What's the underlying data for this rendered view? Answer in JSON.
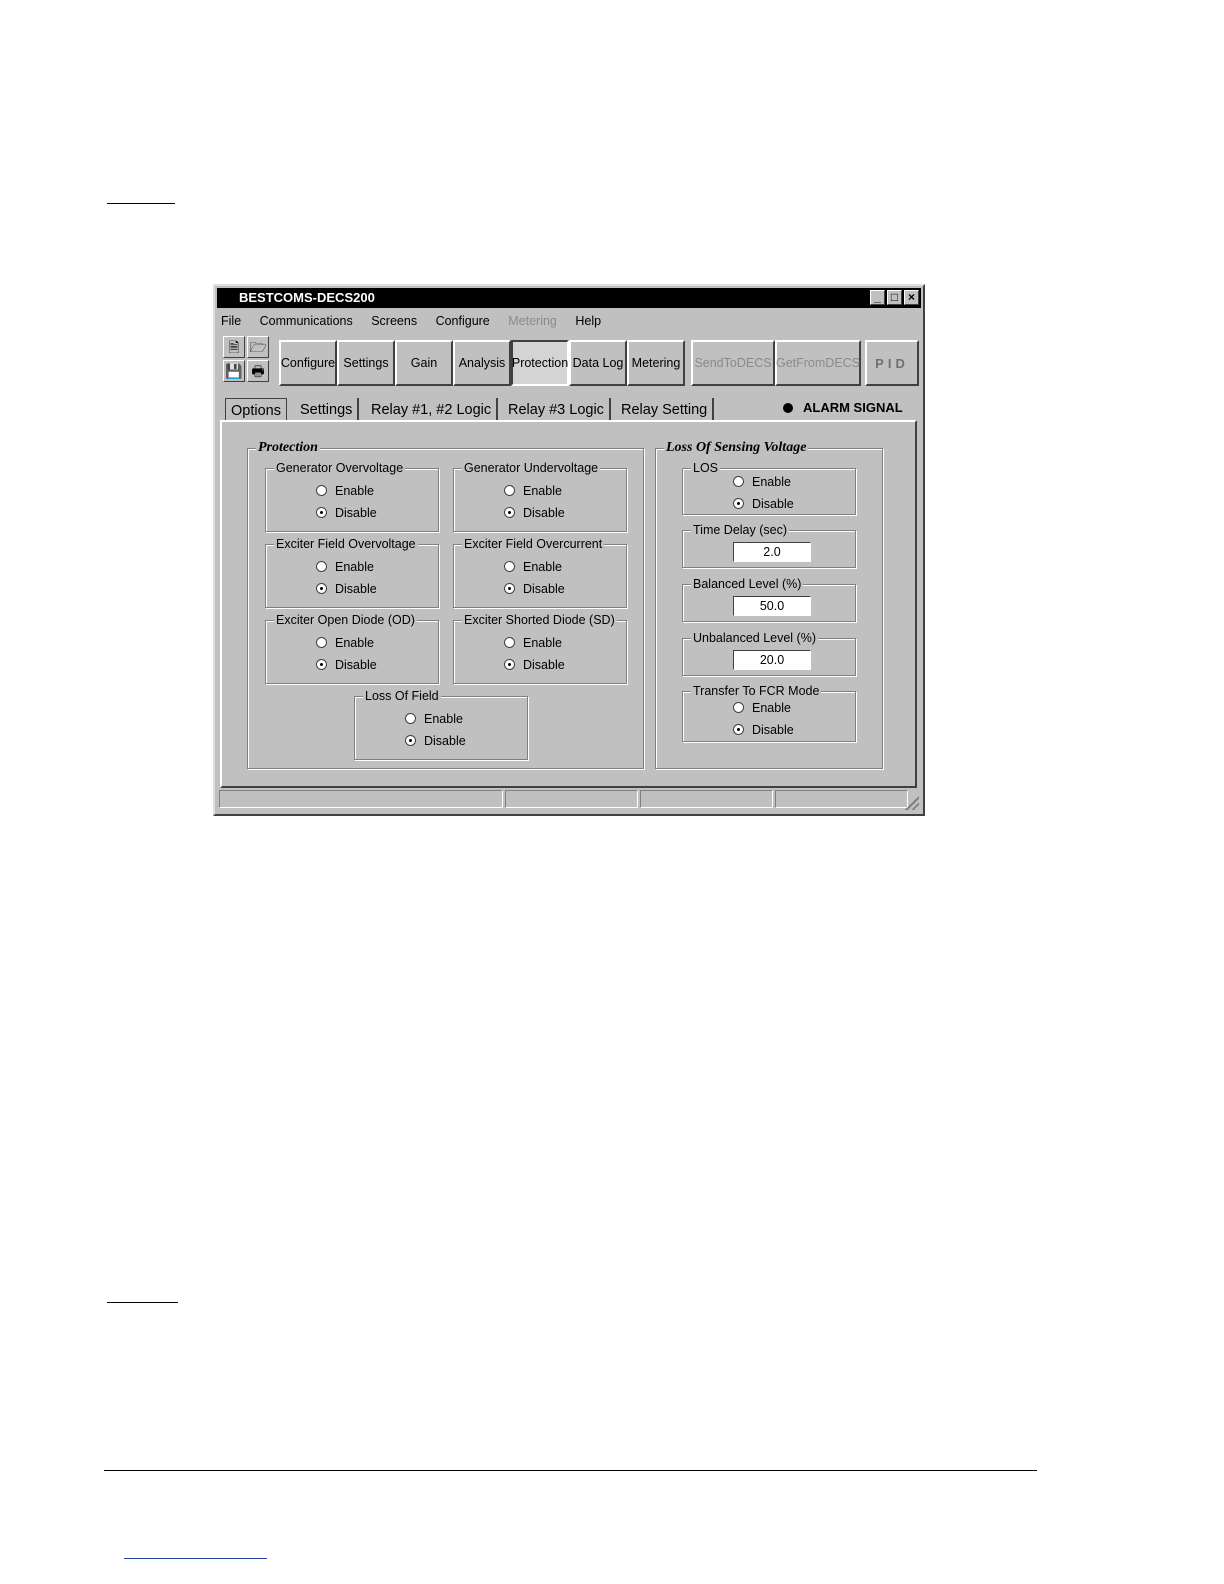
{
  "window": {
    "title": "BESTCOMS-DECS200",
    "minimize_label": "_",
    "maximize_label": "□",
    "close_label": "×"
  },
  "menu": {
    "file": "File",
    "communications": "Communications",
    "screens": "Screens",
    "configure": "Configure",
    "metering": "Metering",
    "help": "Help"
  },
  "toolbar": {
    "buttons": [
      "Configure",
      "Settings",
      "Gain",
      "Analysis",
      "Protection",
      "Data Log",
      "Metering"
    ],
    "send": "SendToDECS",
    "get": "GetFromDECS",
    "pid": "PID"
  },
  "tabs": [
    "Options",
    "Settings",
    "Relay #1, #2 Logic",
    "Relay #3 Logic",
    "Relay Setting"
  ],
  "alarm": "ALARM SIGNAL",
  "protection": {
    "title": "Protection",
    "groups": [
      {
        "title": "Generator Overvoltage",
        "enable": "Enable",
        "disable": "Disable"
      },
      {
        "title": "Generator Undervoltage",
        "enable": "Enable",
        "disable": "Disable"
      },
      {
        "title": "Exciter Field Overvoltage",
        "enable": "Enable",
        "disable": "Disable"
      },
      {
        "title": "Exciter Field Overcurrent",
        "enable": "Enable",
        "disable": "Disable"
      },
      {
        "title": "Exciter Open Diode (OD)",
        "enable": "Enable",
        "disable": "Disable"
      },
      {
        "title": "Exciter Shorted Diode (SD)",
        "enable": "Enable",
        "disable": "Disable"
      },
      {
        "title": "Loss Of Field",
        "enable": "Enable",
        "disable": "Disable"
      }
    ],
    "selected": "Disable"
  },
  "los": {
    "title": "Loss Of Sensing Voltage",
    "los_group": {
      "title": "LOS",
      "enable": "Enable",
      "disable": "Disable"
    },
    "time_delay": {
      "label": "Time Delay (sec)",
      "value": "2.0"
    },
    "balanced": {
      "label": "Balanced Level (%)",
      "value": "50.0"
    },
    "unbalanced": {
      "label": "Unbalanced Level (%)",
      "value": "20.0"
    },
    "fcr": {
      "title": "Transfer To FCR Mode",
      "enable": "Enable",
      "disable": "Disable"
    }
  }
}
